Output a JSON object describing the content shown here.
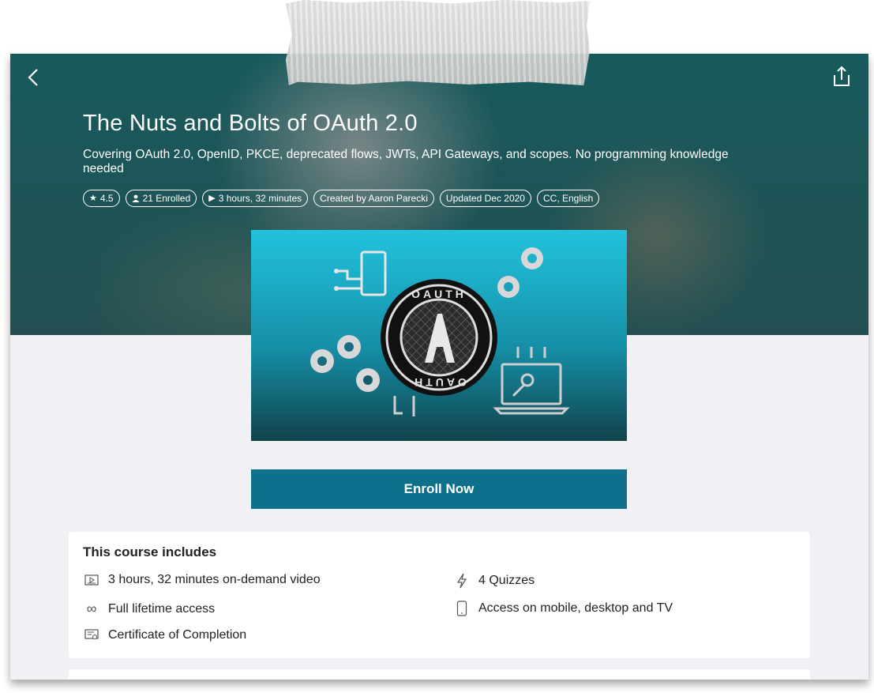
{
  "course": {
    "title": "The Nuts and Bolts of OAuth 2.0",
    "subtitle": "Covering OAuth 2.0, OpenID, PKCE, deprecated flows, JWTs, API Gateways, and scopes. No programming knowledge needed",
    "chips": {
      "rating": "4.5",
      "enrolled": "21 Enrolled",
      "duration": "3 hours, 32 minutes",
      "author": "Created by Aaron Parecki",
      "updated": "Updated Dec 2020",
      "captions": "CC, English"
    }
  },
  "image": {
    "badge_top": "OAUTH",
    "badge_bottom": "OAUTH",
    "badge_letter": "A"
  },
  "enroll_label": "Enroll Now",
  "includes": {
    "heading": "This course includes",
    "items": {
      "video": "3 hours, 32 minutes on-demand video",
      "quizzes": "4 Quizzes",
      "access": "Full lifetime access",
      "devices": "Access on mobile, desktop and TV",
      "certificate": "Certificate of Completion"
    }
  },
  "icons": {
    "back": "chevron-left-icon",
    "share": "share-icon",
    "rating": "star-icon",
    "enrolled": "person-icon",
    "duration": "play-icon",
    "video": "video-icon",
    "quizzes": "lightning-icon",
    "access": "infinity-icon",
    "devices": "mobile-icon",
    "certificate": "certificate-icon"
  },
  "colors": {
    "hero": "#175a5c",
    "enroll": "#0e708b",
    "image_top": "#1fbdd9",
    "image_bottom": "#11464f"
  }
}
